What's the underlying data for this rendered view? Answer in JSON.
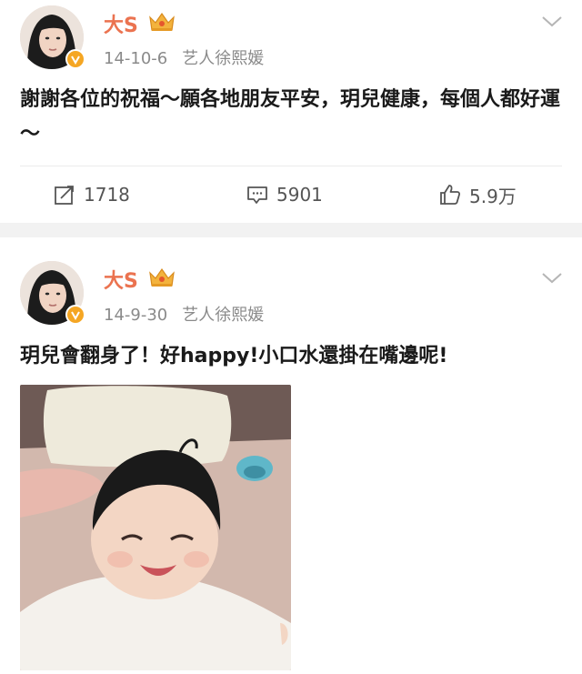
{
  "posts": [
    {
      "username": "大S",
      "date": "14-10-6",
      "source": "艺人徐熙媛",
      "text": "謝謝各位的祝福～願各地朋友平安，玥兒健康，每個人都好運～",
      "reposts": "1718",
      "comments": "5901",
      "likes": "5.9万",
      "verified": true
    },
    {
      "username": "大S",
      "date": "14-9-30",
      "source": "艺人徐熙媛",
      "text": "玥兒會翻身了！好happy!小口水還掛在嘴邊呢!",
      "verified": true
    }
  ],
  "colors": {
    "username": "#eb7350",
    "meta": "#8a8a8a",
    "verified_badge": "#f5a623",
    "separator": "#f2f2f2"
  },
  "icons": {
    "repost": "repost-icon",
    "comment": "comment-icon",
    "like": "like-icon",
    "menu": "chevron-down-icon",
    "member": "crown-icon"
  }
}
